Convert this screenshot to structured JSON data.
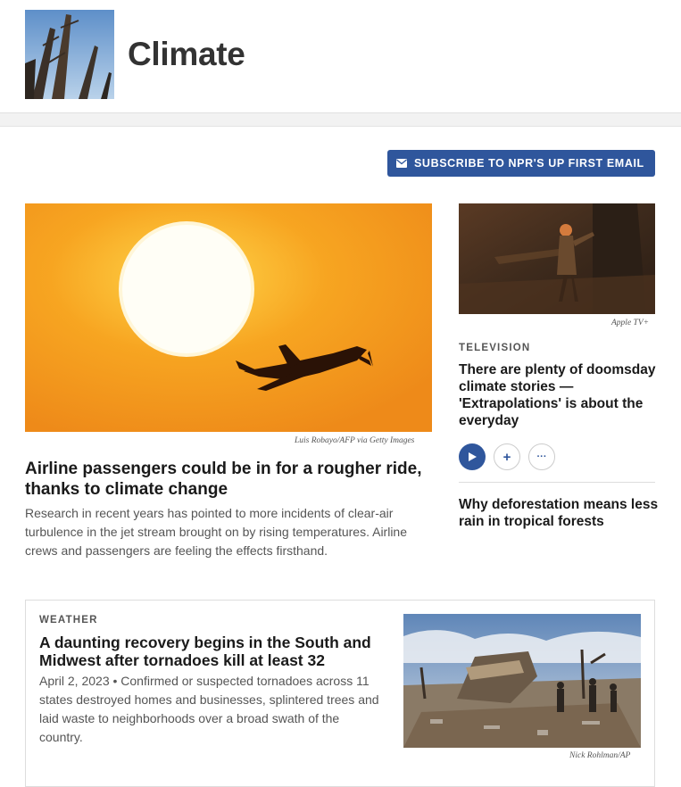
{
  "header": {
    "title": "Climate",
    "image_icon": "tree-photo"
  },
  "subscribe": {
    "label": "SUBSCRIBE TO NPR'S UP FIRST EMAIL",
    "icon": "mail-icon"
  },
  "featured": {
    "image_credit": "Luis Robayo/AFP via Getty Images",
    "title": "Airline passengers could be in for a rougher ride, thanks to climate change",
    "teaser": "Research in recent years has pointed to more incidents of clear-air turbulence in the jet stream brought on by rising temperatures. Airline crews and passengers are feeling the effects firsthand."
  },
  "sidebar": {
    "image_credit": "Apple TV+",
    "slug": "TELEVISION",
    "title": "There are plenty of doomsday climate stories — 'Extrapolations' is about the everyday",
    "actions": {
      "play_icon": "play-icon",
      "add_symbol": "+",
      "more_symbol": "···"
    },
    "second_title": "Why deforestation means less rain in tropical forests"
  },
  "card": {
    "slug": "WEATHER",
    "title": "A daunting recovery begins in the South and Midwest after tornadoes kill at least 32",
    "teaser": "April 2, 2023 • Confirmed or suspected tornadoes across 11 states destroyed homes and businesses, splintered trees and laid waste to neighborhoods over a broad swath of the country.",
    "image_credit": "Nick Rohlman/AP"
  },
  "colors": {
    "accent": "#2f569c",
    "sky_orange": "#f39a1e"
  }
}
